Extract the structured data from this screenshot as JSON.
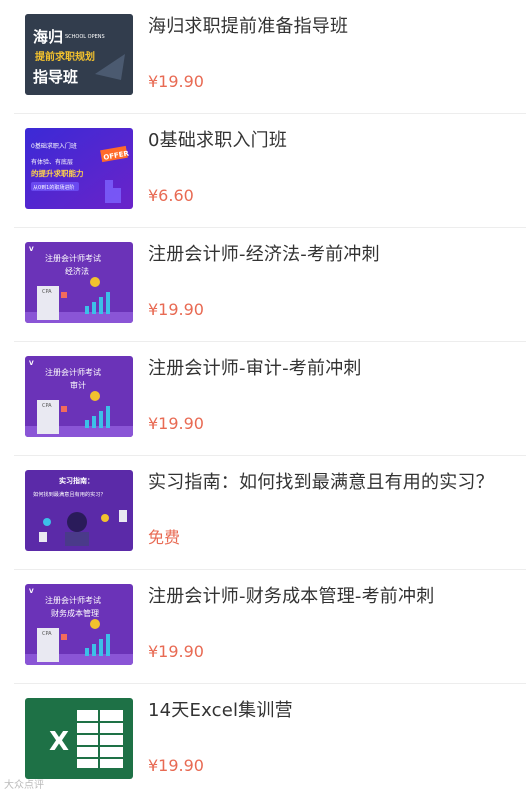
{
  "courses": [
    {
      "title": "海归求职提前准备指导班",
      "price": "¥19.90",
      "thumb": {
        "line1": "海归",
        "line2": "SCHOOL OPENS",
        "line3": "提前求职规划",
        "line4": "指导班"
      }
    },
    {
      "title": "0基础求职入门班",
      "price": "¥6.60",
      "thumb": {
        "line1": "0基础求职入门班",
        "line2": "有体验、有底层",
        "line3": "的提升求职能力",
        "line4": "从0到1的职场进阶",
        "badge": "OFFER"
      }
    },
    {
      "title": "注册会计师-经济法-考前冲刺",
      "price": "¥19.90",
      "thumb": {
        "line1": "注册会计师考试",
        "line2": "经济法",
        "cpa": "CPA"
      }
    },
    {
      "title": "注册会计师-审计-考前冲刺",
      "price": "¥19.90",
      "thumb": {
        "line1": "注册会计师考试",
        "line2": "审计",
        "cpa": "CPA"
      }
    },
    {
      "title": "实习指南：如何找到最满意且有用的实习？",
      "price": "免费",
      "thumb": {
        "line1": "实习指南：",
        "line2": "如何找到最满意且有用的实习？"
      }
    },
    {
      "title": "注册会计师-财务成本管理-考前冲刺",
      "price": "¥19.90",
      "thumb": {
        "line1": "注册会计师考试",
        "line2": "财务成本管理",
        "cpa": "CPA"
      }
    },
    {
      "title": "14天Excel集训营",
      "price": "¥19.90",
      "thumb": {
        "letter": "X"
      }
    }
  ],
  "watermark": "大众点评"
}
